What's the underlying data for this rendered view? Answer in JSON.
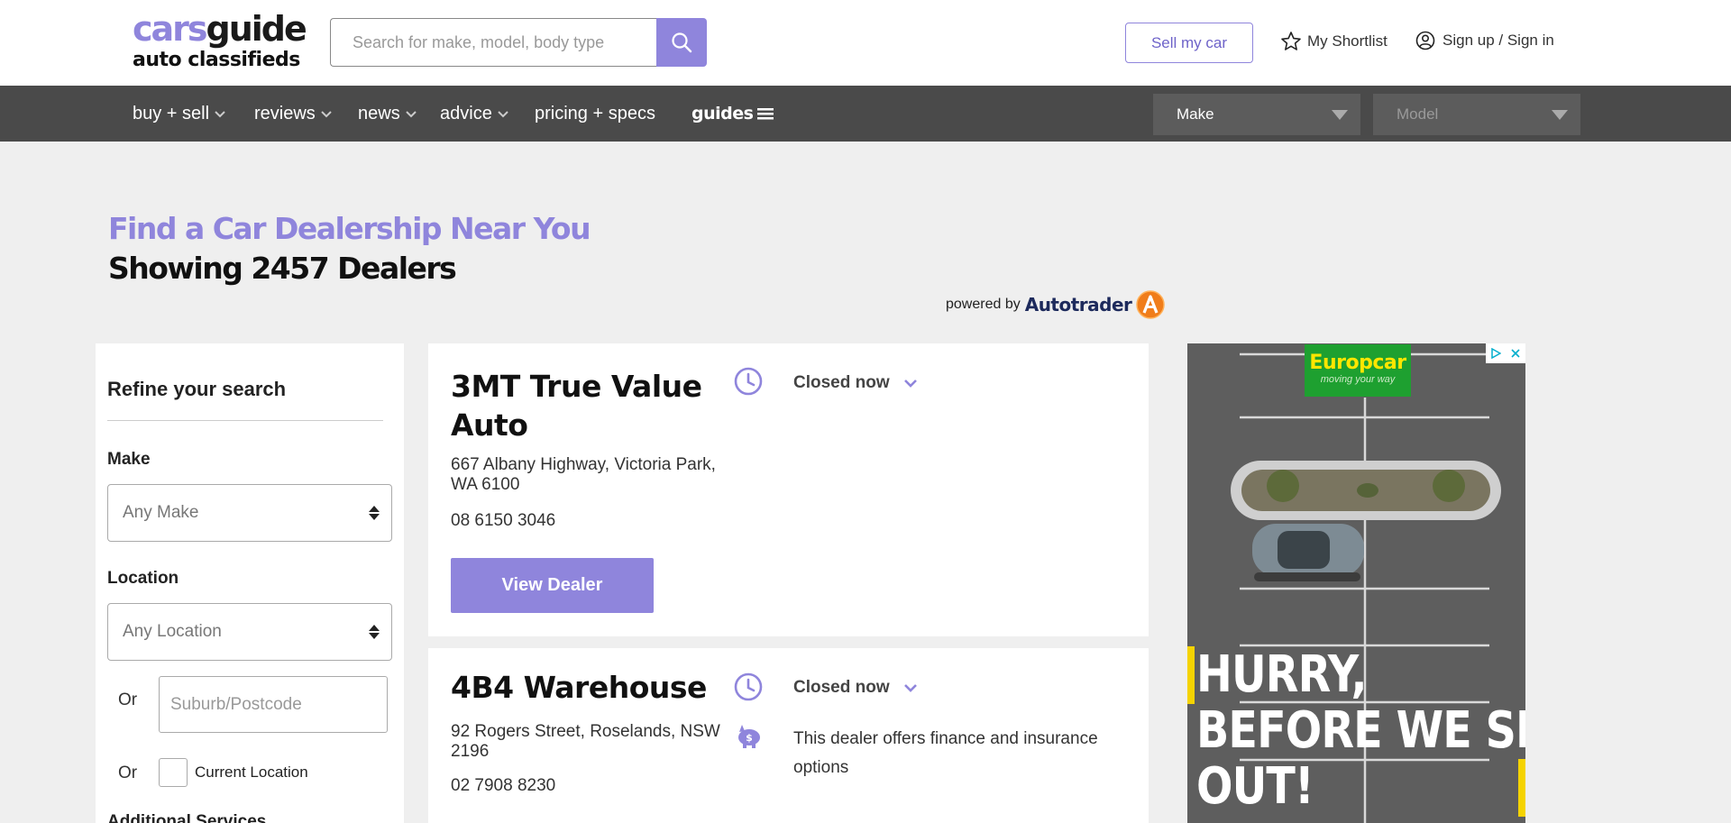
{
  "header": {
    "logo_cars": "cars",
    "logo_guide": "guide",
    "logo_sub": "auto classifieds",
    "search_placeholder": "Search for make, model, body type",
    "sell_label": "Sell my car",
    "shortlist_label": "My Shortlist",
    "signin_label": "Sign up / Sign in"
  },
  "nav": {
    "items": [
      {
        "label": "buy + sell"
      },
      {
        "label": "reviews"
      },
      {
        "label": "news"
      },
      {
        "label": "advice"
      },
      {
        "label": "pricing + specs"
      },
      {
        "label": "guides"
      }
    ],
    "make_select": "Make",
    "model_select": "Model"
  },
  "page": {
    "title": "Find a Car Dealership Near You",
    "subtitle": "Showing 2457 Dealers",
    "powered_by": "powered by",
    "powered_brand": "Autotrader"
  },
  "sidebar": {
    "title": "Refine your search",
    "make_label": "Make",
    "make_value": "Any Make",
    "location_label": "Location",
    "location_value": "Any Location",
    "or_1": "Or",
    "suburb_placeholder": "Suburb/Postcode",
    "or_2": "Or",
    "current_location": "Current Location",
    "additional_services": "Additional Services"
  },
  "dealers": [
    {
      "name": "3MT True Value Auto",
      "address": "667 Albany Highway, Victoria Park, WA 6100",
      "phone": "08 6150 3046",
      "status": "Closed now",
      "button": "View Dealer"
    },
    {
      "name": "4B4 Warehouse",
      "address": "92 Rogers Street, Roselands, NSW 2196",
      "phone": "02 7908 8230",
      "status": "Closed now",
      "finance": "This dealer offers finance and insurance options"
    }
  ],
  "ad": {
    "brand": "Europcar",
    "tagline": "moving your way",
    "headline_1": "HURRY,",
    "headline_2": "BEFORE WE SELL",
    "headline_3": "OUT!"
  },
  "colors": {
    "accent": "#8f85dc",
    "nav_bg": "#4a4a4a",
    "page_bg": "#efefef"
  }
}
